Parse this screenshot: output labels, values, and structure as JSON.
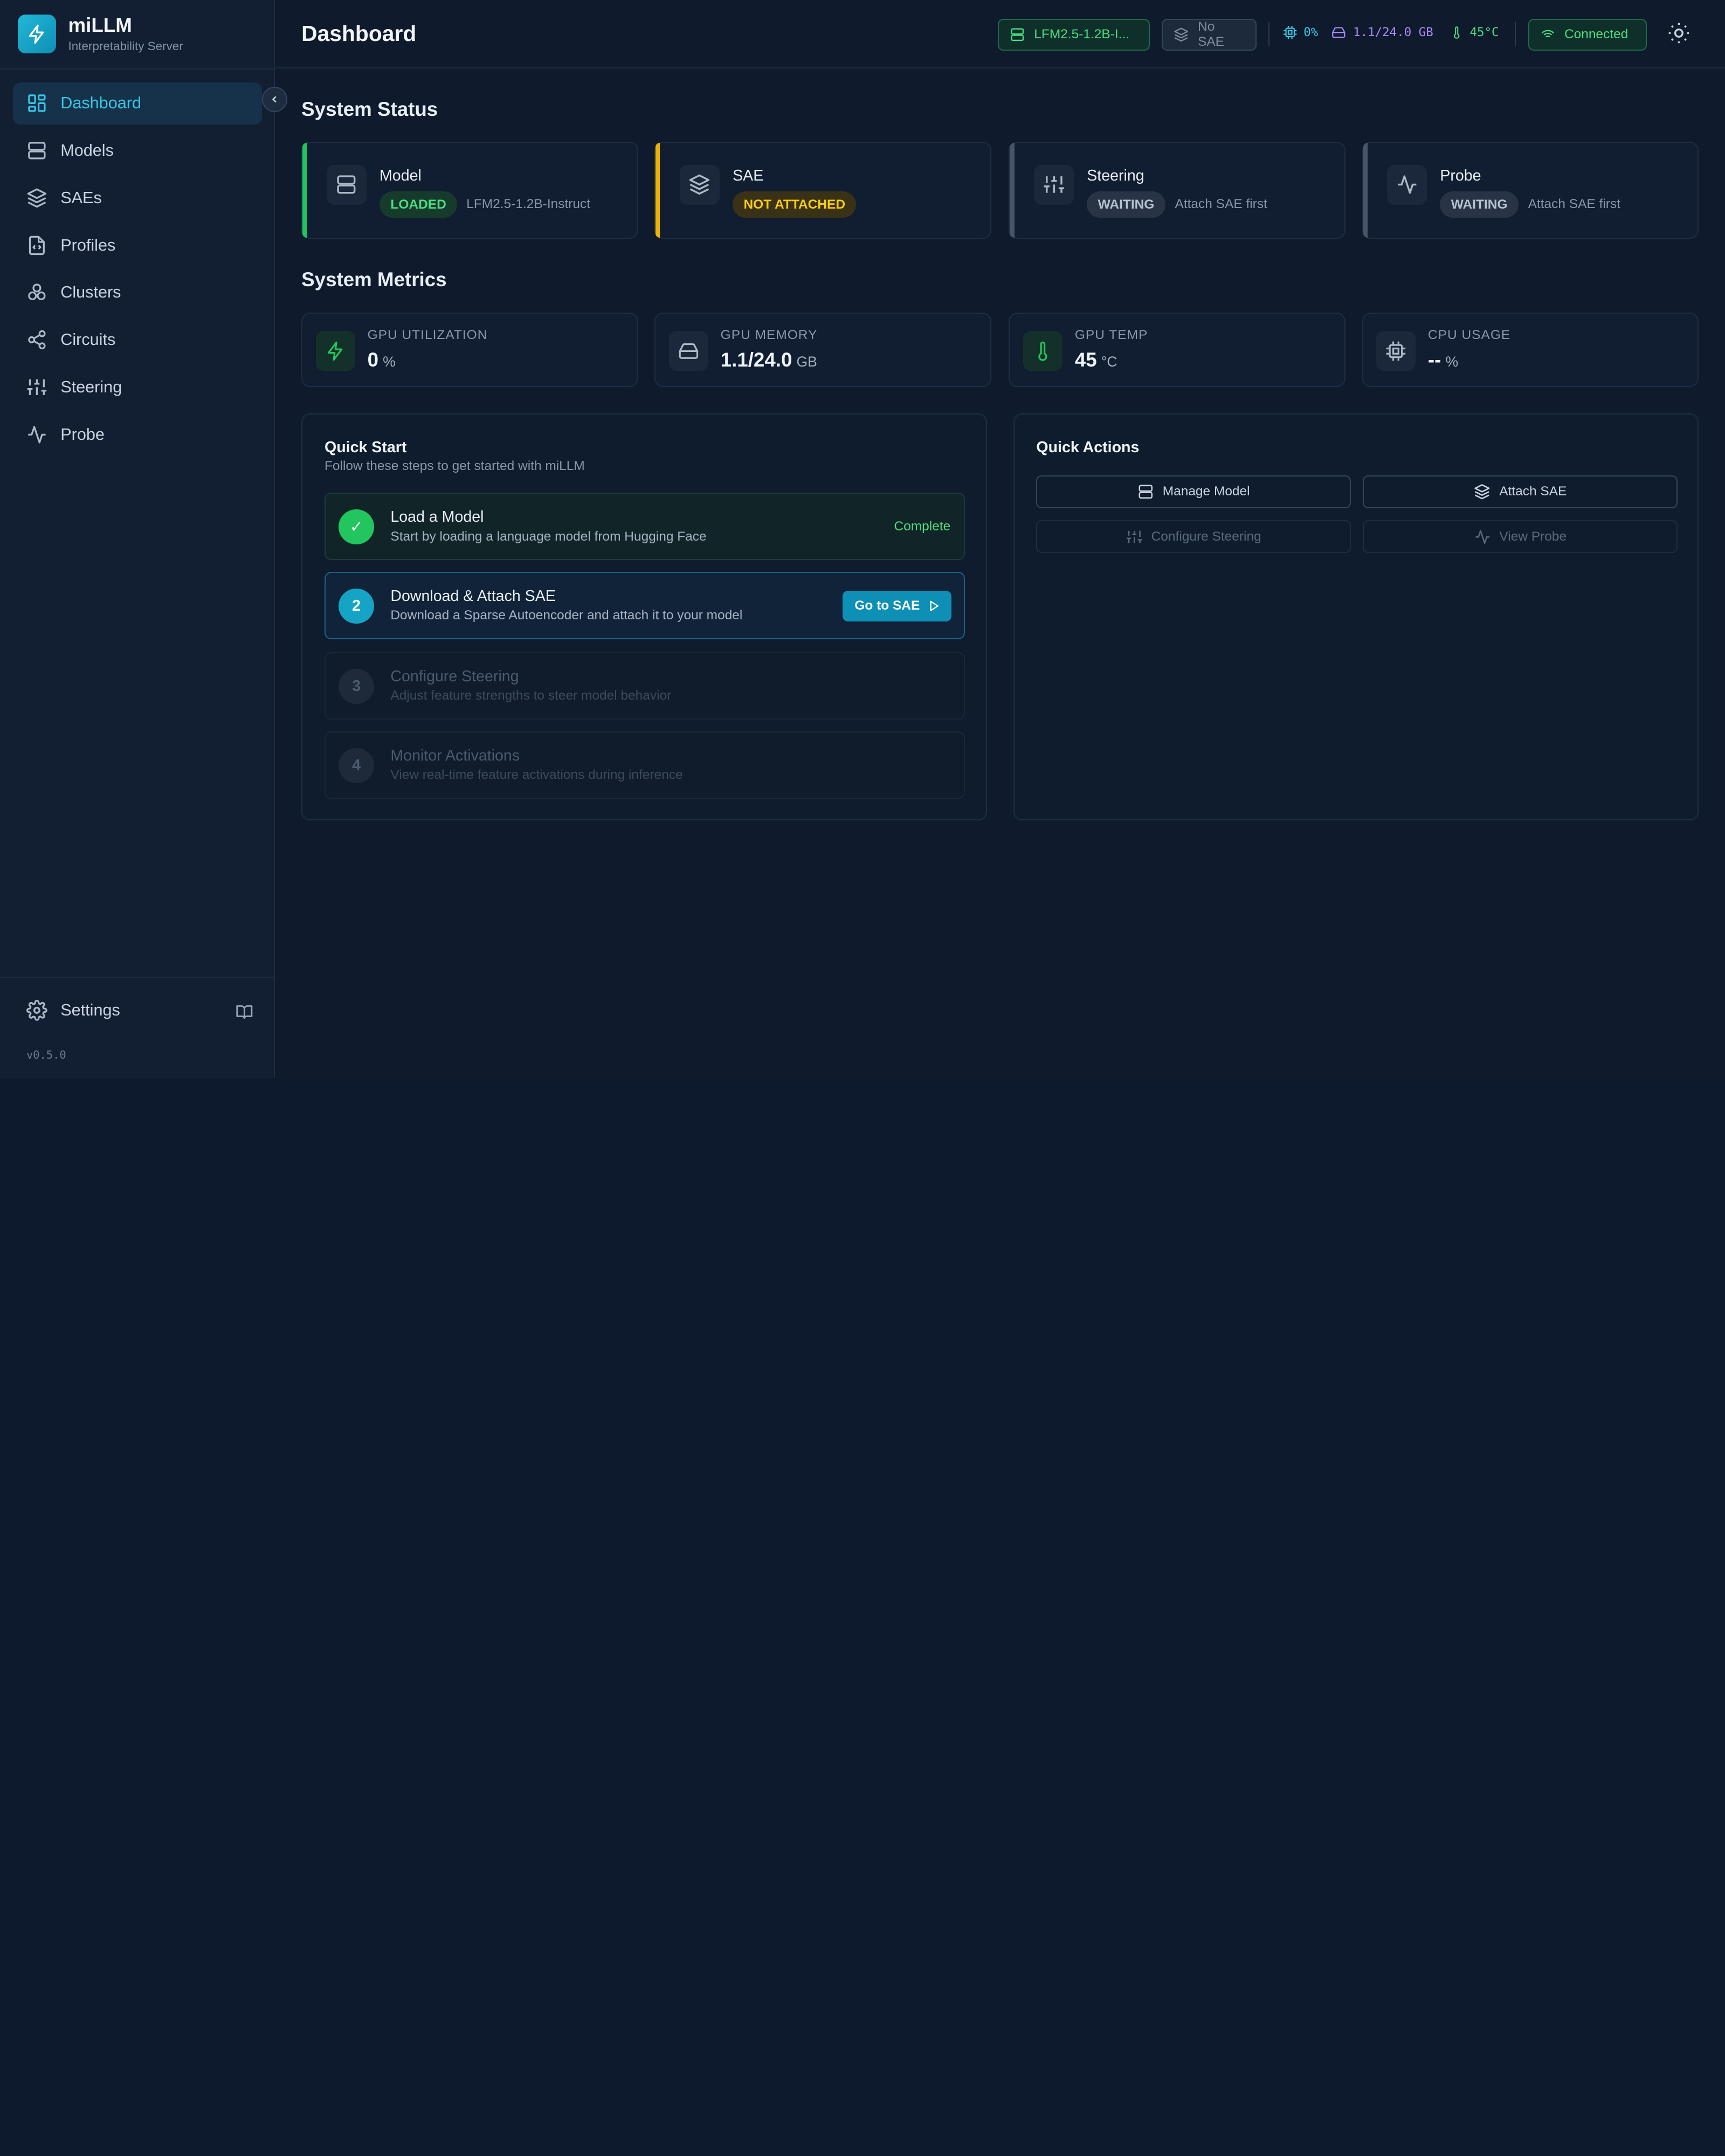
{
  "brand": {
    "name": "miLLM",
    "subtitle": "Interpretability Server"
  },
  "sidebar": {
    "items": [
      {
        "label": "Dashboard",
        "icon": "dashboard-grid-icon",
        "active": true
      },
      {
        "label": "Models",
        "icon": "server-icon"
      },
      {
        "label": "SAEs",
        "icon": "layers-icon"
      },
      {
        "label": "Profiles",
        "icon": "file-code-icon"
      },
      {
        "label": "Clusters",
        "icon": "boxes-icon"
      },
      {
        "label": "Circuits",
        "icon": "share-nodes-icon"
      },
      {
        "label": "Steering",
        "icon": "sliders-icon"
      },
      {
        "label": "Probe",
        "icon": "activity-icon"
      }
    ],
    "settings_label": "Settings",
    "version": "v0.5.0"
  },
  "header": {
    "title": "Dashboard",
    "model_pill": "LFM2.5-1.2B-I...",
    "sae_pill": "No SAE",
    "gpu_util": "0%",
    "gpu_mem": "1.1/24.0 GB",
    "gpu_temp": "45°C",
    "connection": "Connected"
  },
  "system_status": {
    "title": "System Status",
    "cards": [
      {
        "name": "Model",
        "badge": "LOADED",
        "detail": "LFM2.5-1.2B-Instruct",
        "accent": "#22c55e"
      },
      {
        "name": "SAE",
        "badge": "NOT ATTACHED",
        "detail": "",
        "accent": "#eab308"
      },
      {
        "name": "Steering",
        "badge": "WAITING",
        "detail": "Attach SAE first",
        "accent": "#475569"
      },
      {
        "name": "Probe",
        "badge": "WAITING",
        "detail": "Attach SAE first",
        "accent": "#475569"
      }
    ]
  },
  "system_metrics": {
    "title": "System Metrics",
    "cards": [
      {
        "label": "GPU UTILIZATION",
        "value": "0",
        "unit": "%"
      },
      {
        "label": "GPU MEMORY",
        "value": "1.1/24.0",
        "unit": "GB"
      },
      {
        "label": "GPU TEMP",
        "value": "45",
        "unit": "°C"
      },
      {
        "label": "CPU USAGE",
        "value": "--",
        "unit": "%"
      }
    ]
  },
  "quick_start": {
    "title": "Quick Start",
    "subtitle": "Follow these steps to get started with miLLM",
    "steps": [
      {
        "num": "✓",
        "title": "Load a Model",
        "desc": "Start by loading a language model from Hugging Face",
        "status": "Complete"
      },
      {
        "num": "2",
        "title": "Download & Attach SAE",
        "desc": "Download a Sparse Autoencoder and attach it to your model",
        "action": "Go to SAE"
      },
      {
        "num": "3",
        "title": "Configure Steering",
        "desc": "Adjust feature strengths to steer model behavior"
      },
      {
        "num": "4",
        "title": "Monitor Activations",
        "desc": "View real-time feature activations during inference"
      }
    ]
  },
  "quick_actions": {
    "title": "Quick Actions",
    "buttons": [
      "Manage Model",
      "Attach SAE",
      "Configure Steering",
      "View Probe"
    ]
  },
  "colors": {
    "accent": "#22b8d6",
    "success": "#22c55e",
    "warning": "#eab308",
    "background": "#0f1b2d"
  }
}
